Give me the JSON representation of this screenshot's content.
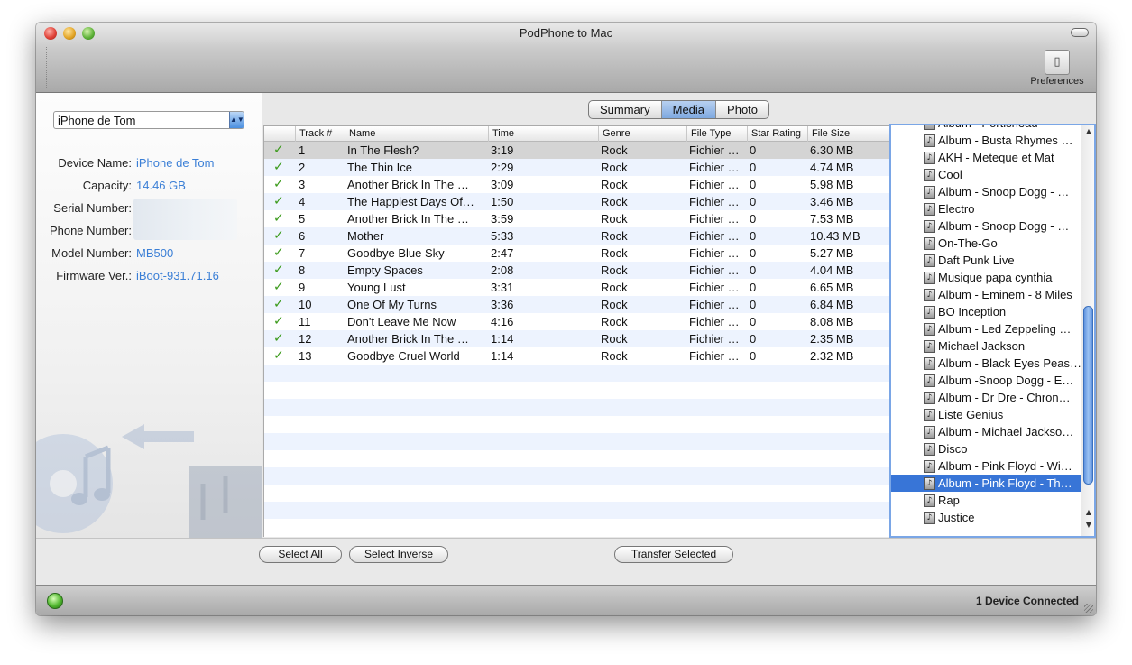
{
  "window": {
    "title": "PodPhone to Mac"
  },
  "toolbar": {
    "preferences_label": "Preferences",
    "preferences_icon": "switch-icon"
  },
  "device": {
    "selected": "iPhone de Tom",
    "fields": [
      {
        "label": "Device Name:",
        "value": "iPhone de Tom"
      },
      {
        "label": "Capacity:",
        "value": "14.46 GB"
      },
      {
        "label": "Serial Number:",
        "value": ""
      },
      {
        "label": "Phone Number:",
        "value": ""
      },
      {
        "label": "Model Number:",
        "value": "MB500"
      },
      {
        "label": "Firmware Ver.:",
        "value": "iBoot-931.71.16"
      }
    ]
  },
  "tabs": [
    {
      "label": "Summary",
      "active": false
    },
    {
      "label": "Media",
      "active": true
    },
    {
      "label": "Photo",
      "active": false
    }
  ],
  "table": {
    "columns": [
      "Track #",
      "Name",
      "Time",
      "Genre",
      "File Type",
      "Star Rating",
      "File Size"
    ],
    "rows": [
      {
        "track": "1",
        "name": "In The Flesh?",
        "time": "3:19",
        "genre": "Rock",
        "type": "Fichier …",
        "rating": "0",
        "size": "6.30 MB"
      },
      {
        "track": "2",
        "name": "The Thin Ice",
        "time": "2:29",
        "genre": "Rock",
        "type": "Fichier …",
        "rating": "0",
        "size": "4.74 MB"
      },
      {
        "track": "3",
        "name": "Another Brick In The …",
        "time": "3:09",
        "genre": "Rock",
        "type": "Fichier …",
        "rating": "0",
        "size": "5.98 MB"
      },
      {
        "track": "4",
        "name": "The Happiest Days Of…",
        "time": "1:50",
        "genre": "Rock",
        "type": "Fichier …",
        "rating": "0",
        "size": "3.46 MB"
      },
      {
        "track": "5",
        "name": "Another Brick In The …",
        "time": "3:59",
        "genre": "Rock",
        "type": "Fichier …",
        "rating": "0",
        "size": "7.53 MB"
      },
      {
        "track": "6",
        "name": "Mother",
        "time": "5:33",
        "genre": "Rock",
        "type": "Fichier …",
        "rating": "0",
        "size": "10.43 MB"
      },
      {
        "track": "7",
        "name": "Goodbye Blue Sky",
        "time": "2:47",
        "genre": "Rock",
        "type": "Fichier …",
        "rating": "0",
        "size": "5.27 MB"
      },
      {
        "track": "8",
        "name": "Empty Spaces",
        "time": "2:08",
        "genre": "Rock",
        "type": "Fichier …",
        "rating": "0",
        "size": "4.04 MB"
      },
      {
        "track": "9",
        "name": "Young Lust",
        "time": "3:31",
        "genre": "Rock",
        "type": "Fichier …",
        "rating": "0",
        "size": "6.65 MB"
      },
      {
        "track": "10",
        "name": "One Of My Turns",
        "time": "3:36",
        "genre": "Rock",
        "type": "Fichier …",
        "rating": "0",
        "size": "6.84 MB"
      },
      {
        "track": "11",
        "name": "Don't Leave Me Now",
        "time": "4:16",
        "genre": "Rock",
        "type": "Fichier …",
        "rating": "0",
        "size": "8.08 MB"
      },
      {
        "track": "12",
        "name": "Another Brick In The …",
        "time": "1:14",
        "genre": "Rock",
        "type": "Fichier …",
        "rating": "0",
        "size": "2.35 MB"
      },
      {
        "track": "13",
        "name": "Goodbye Cruel World",
        "time": "1:14",
        "genre": "Rock",
        "type": "Fichier …",
        "rating": "0",
        "size": "2.32 MB"
      }
    ]
  },
  "playlists": [
    "Album - Portishead",
    "Album - Busta Rhymes …",
    "AKH - Meteque et Mat",
    "Cool",
    "Album - Snoop Dogg - …",
    "Electro",
    "Album - Snoop Dogg - …",
    "On-The-Go",
    "Daft Punk Live",
    "Musique papa cynthia",
    "Album - Eminem - 8 Miles",
    "BO Inception",
    "Album - Led Zeppeling …",
    "Michael Jackson",
    "Album - Black Eyes Peas…",
    "Album -Snoop Dogg - E…",
    "Album - Dr Dre - Chron…",
    "Liste Genius",
    "Album - Michael Jackso…",
    "Disco",
    "Album - Pink Floyd - Wi…",
    "Album - Pink Floyd - Th…",
    "Rap",
    "Justice"
  ],
  "playlist_selected_index": 21,
  "buttons": {
    "select_all": "Select All",
    "select_inverse": "Select Inverse",
    "transfer_selected": "Transfer Selected"
  },
  "status": {
    "text": "1 Device Connected",
    "indicator_color": "#52b830"
  }
}
